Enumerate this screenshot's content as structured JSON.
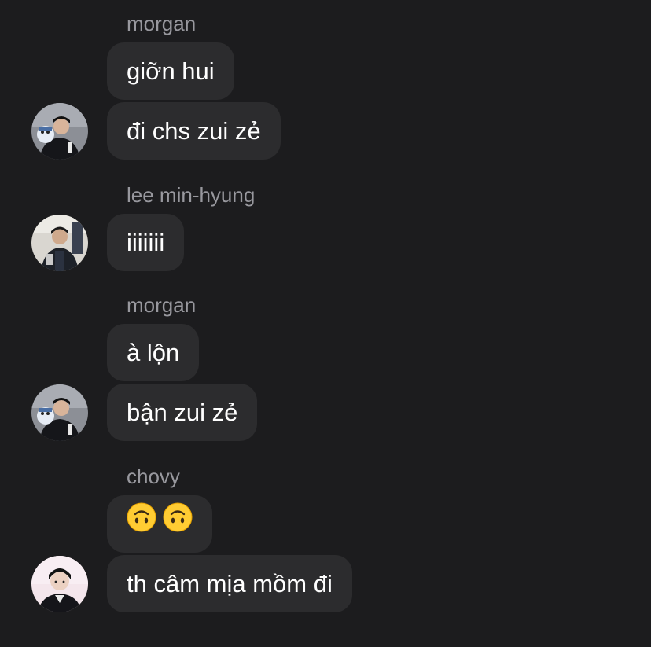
{
  "groups": [
    {
      "sender": "morgan",
      "messages": [
        {
          "text": "giỡn hui"
        },
        {
          "text": "đi chs zui zẻ"
        }
      ]
    },
    {
      "sender": "lee min-hyung",
      "messages": [
        {
          "text": "iiiiiii"
        }
      ]
    },
    {
      "sender": "morgan",
      "messages": [
        {
          "text": "à lộn"
        },
        {
          "text": "bận zui zẻ"
        }
      ]
    },
    {
      "sender": "chovy",
      "messages": [
        {
          "emoji": [
            "upside-down-face",
            "upside-down-face"
          ]
        },
        {
          "text": "th câm mịa mồm đi"
        }
      ]
    }
  ],
  "colors": {
    "background": "#1c1c1e",
    "bubble": "#2c2c2e",
    "sender_name": "#98989e",
    "text": "#ffffff"
  }
}
